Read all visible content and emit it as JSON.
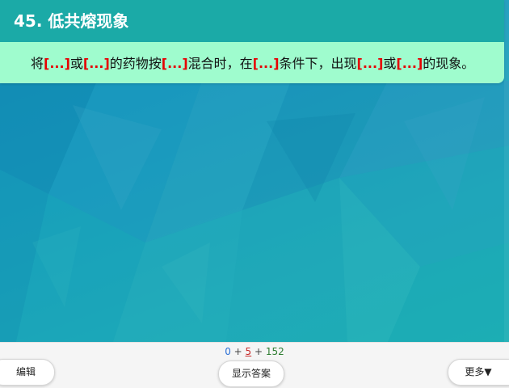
{
  "card": {
    "title": "45. 低共熔现象",
    "segments": [
      {
        "text": "将",
        "cloze": false
      },
      {
        "text": "[...]",
        "cloze": true
      },
      {
        "text": "或",
        "cloze": false
      },
      {
        "text": "[...]",
        "cloze": true
      },
      {
        "text": "的药物按",
        "cloze": false
      },
      {
        "text": "[...]",
        "cloze": true
      },
      {
        "text": "混合时，在",
        "cloze": false
      },
      {
        "text": "[...]",
        "cloze": true
      },
      {
        "text": "条件下，出现",
        "cloze": false
      },
      {
        "text": "[...]",
        "cloze": true
      },
      {
        "text": "或",
        "cloze": false
      },
      {
        "text": "[...]",
        "cloze": true
      },
      {
        "text": "的现象。",
        "cloze": false
      }
    ]
  },
  "counts": {
    "new": "0",
    "learning": "5",
    "review": "152",
    "separator": "+"
  },
  "toolbar": {
    "edit_label": "编辑",
    "show_answer_label": "显示答案",
    "more_label": "更多▼"
  },
  "colors": {
    "title_bar": "#1baaa7",
    "body_bg": "#9ffcce",
    "cloze": "#e60000",
    "new_count": "#2a6fd6",
    "learning_count": "#c62828",
    "review_count": "#2e7d32"
  }
}
